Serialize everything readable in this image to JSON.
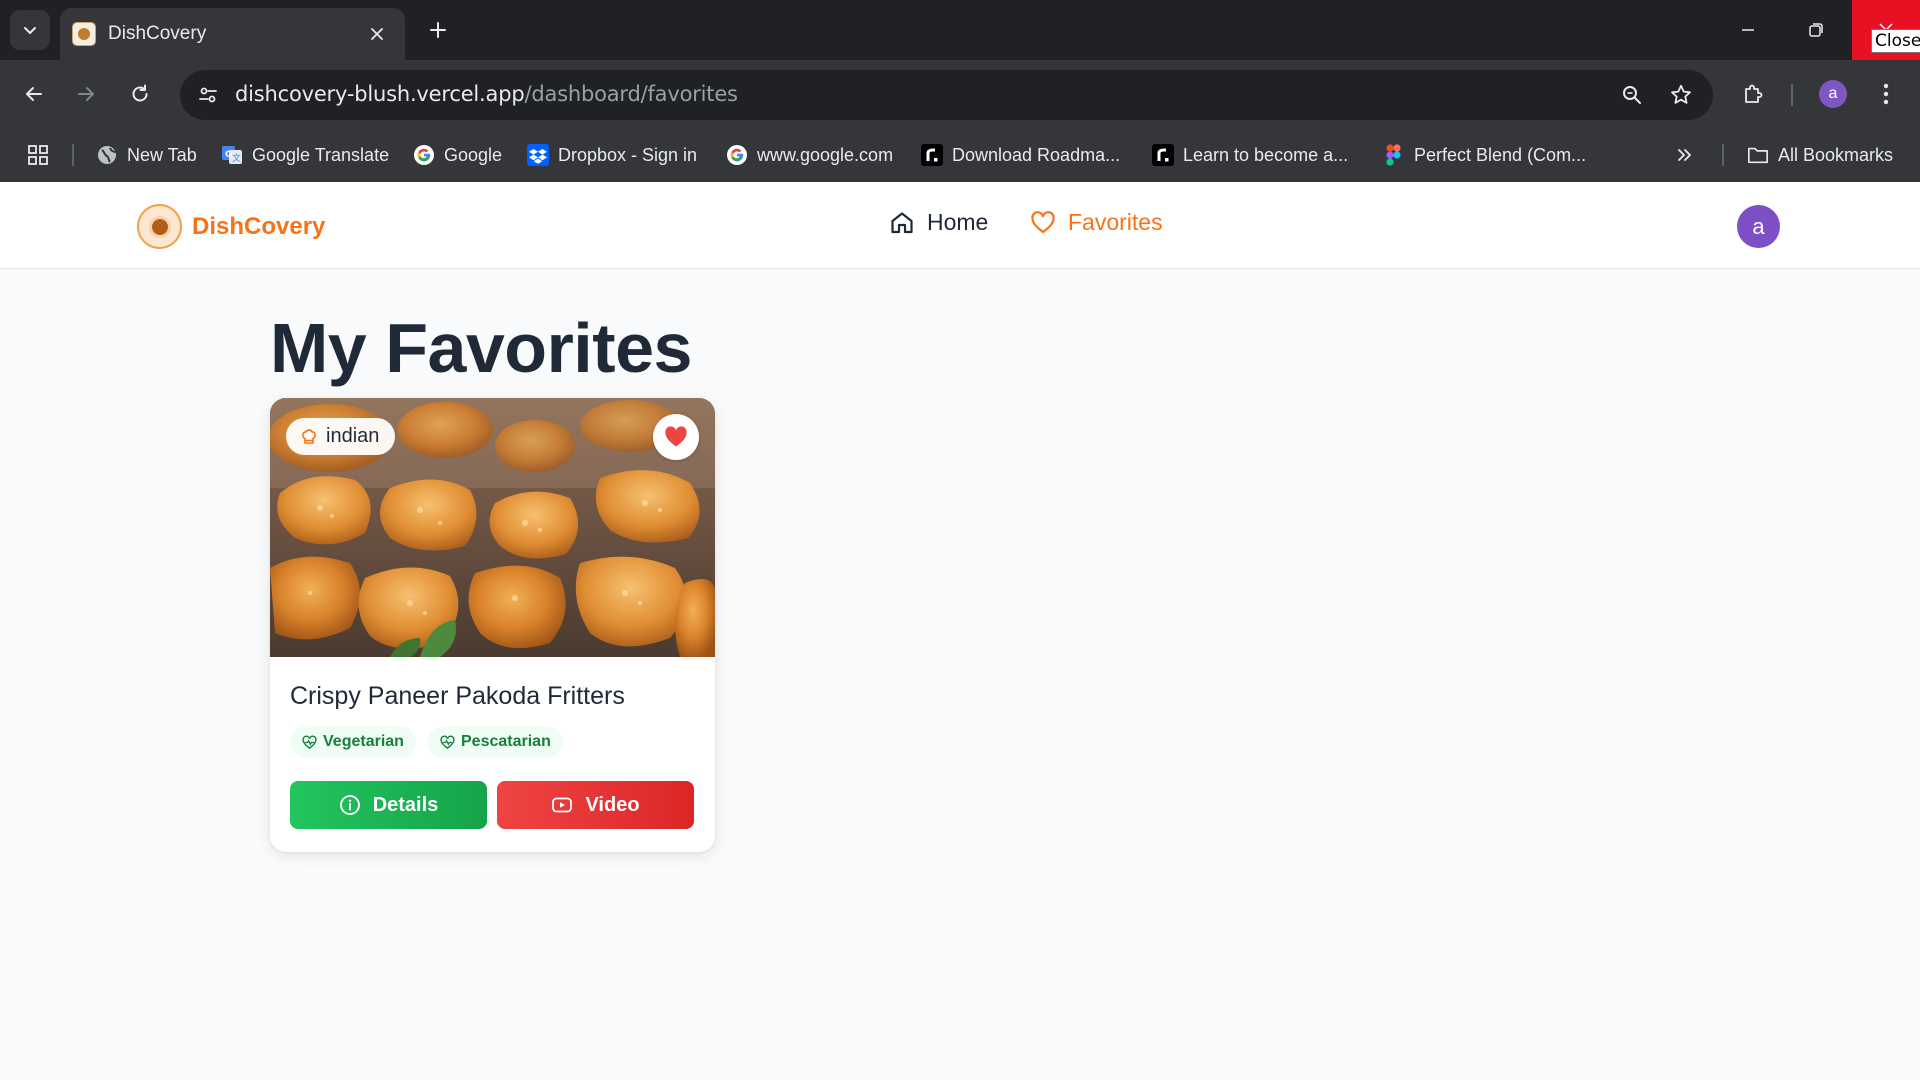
{
  "browser": {
    "tab_title": "DishCovery",
    "url_host": "dishcovery-blush.vercel.app",
    "url_path": "/dashboard/favorites",
    "profile_initial": "a",
    "close_tooltip": "Close",
    "bookmarks": [
      {
        "label": "New Tab",
        "icon": "globe-icon"
      },
      {
        "label": "Google Translate",
        "icon": "google-translate-icon"
      },
      {
        "label": "Google",
        "icon": "google-icon"
      },
      {
        "label": "Dropbox - Sign in",
        "icon": "dropbox-icon"
      },
      {
        "label": "www.google.com",
        "icon": "google-icon"
      },
      {
        "label": "Download Roadma...",
        "icon": "roadmap-icon"
      },
      {
        "label": "Learn to become a...",
        "icon": "roadmap-icon"
      },
      {
        "label": "Perfect Blend (Com...",
        "icon": "figma-icon"
      }
    ],
    "all_bookmarks": "All Bookmarks"
  },
  "app": {
    "brand": "DishCovery",
    "nav": {
      "home": "Home",
      "favorites": "Favorites"
    },
    "user_initial": "a",
    "accent_color": "#f97316"
  },
  "page": {
    "title": "My Favorites"
  },
  "favorites": [
    {
      "cuisine": "indian",
      "title": "Crispy Paneer Pakoda Fritters",
      "tags": [
        "Vegetarian",
        "Pescatarian"
      ],
      "details_label": "Details",
      "video_label": "Video",
      "favorited": true
    }
  ]
}
